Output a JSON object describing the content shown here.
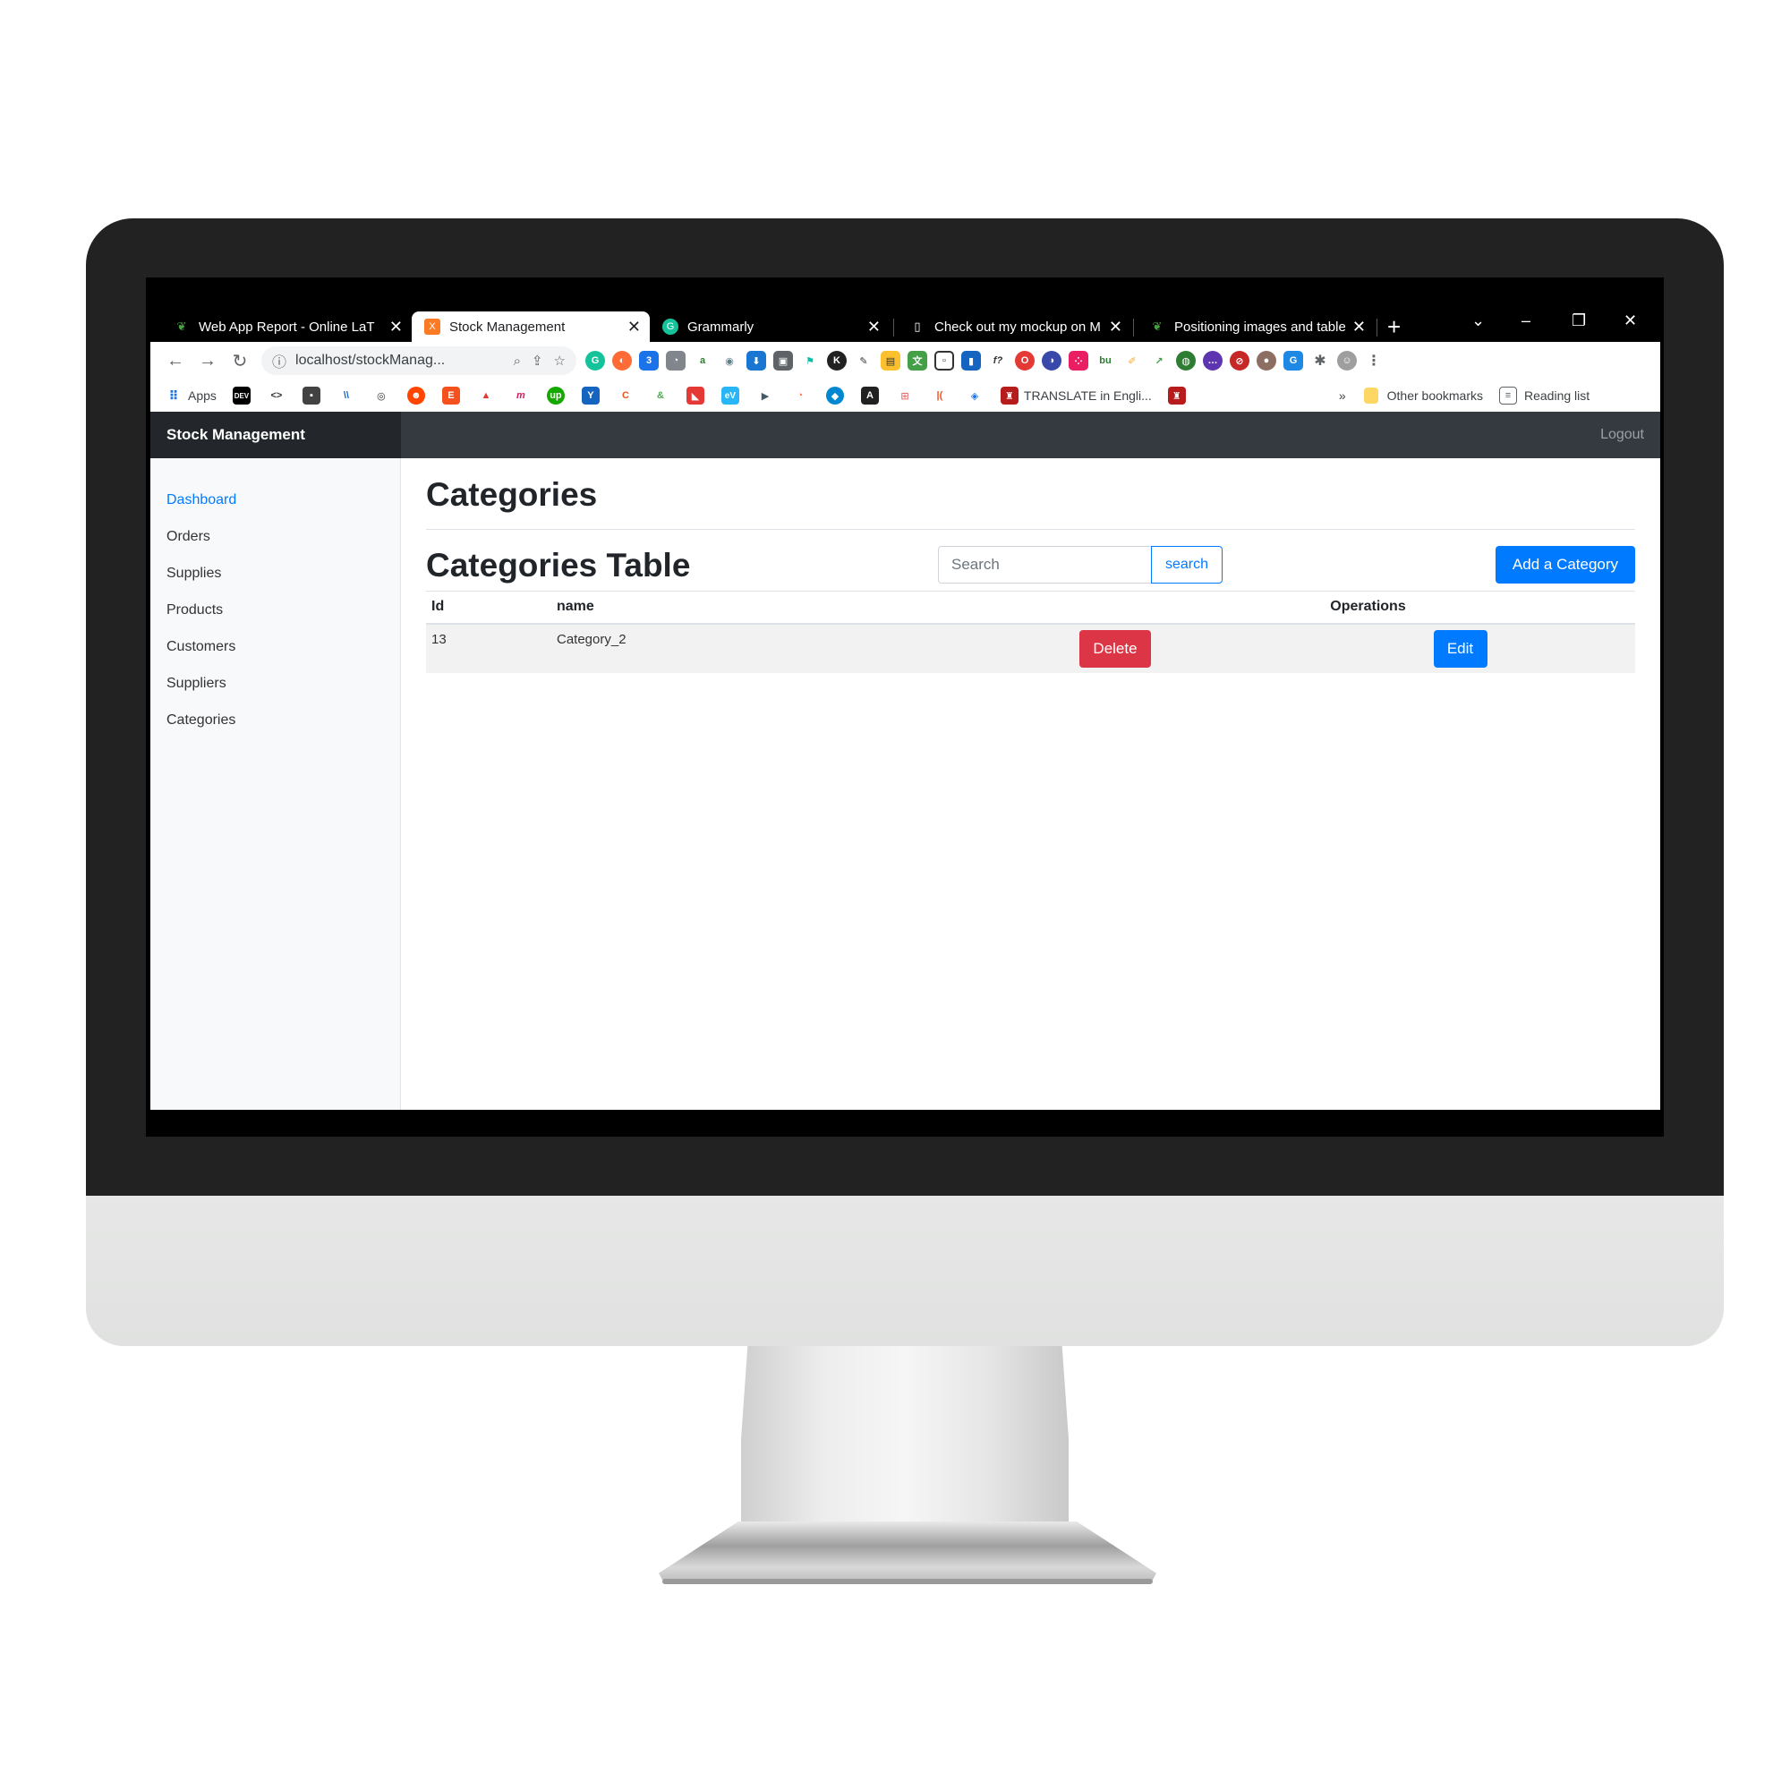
{
  "browser": {
    "tabs": [
      {
        "title": "Web App Report - Online LaT",
        "icon": "overleaf-icon",
        "active": false
      },
      {
        "title": "Stock Management",
        "icon": "xampp-icon",
        "active": true
      },
      {
        "title": "Grammarly",
        "icon": "grammarly-icon",
        "active": false
      },
      {
        "title": "Check out my mockup on M",
        "icon": "mockup-icon",
        "active": false
      },
      {
        "title": "Positioning images and table",
        "icon": "overleaf-icon",
        "active": false
      }
    ],
    "url": "localhost/stockManag...",
    "bookmarks": {
      "apps_label": "Apps",
      "translate_label": "TRANSLATE in Engli...",
      "overflow": "»",
      "other_label": "Other bookmarks",
      "reading_label": "Reading list"
    },
    "colors": {
      "tabbar": "#000000",
      "omnibox": "#f1f3f4"
    }
  },
  "app": {
    "brand": "Stock Management",
    "logout_label": "Logout",
    "sidebar": {
      "items": [
        {
          "label": "Dashboard",
          "active": true
        },
        {
          "label": "Orders",
          "active": false
        },
        {
          "label": "Supplies",
          "active": false
        },
        {
          "label": "Products",
          "active": false
        },
        {
          "label": "Customers",
          "active": false
        },
        {
          "label": "Suppliers",
          "active": false
        },
        {
          "label": "Categories",
          "active": false
        }
      ]
    },
    "main": {
      "page_title": "Categories",
      "table_title": "Categories Table",
      "search": {
        "placeholder": "Search",
        "button_label": "search"
      },
      "add_button_label": "Add a Category",
      "table": {
        "headers": {
          "id": "Id",
          "name": "name",
          "operations": "Operations"
        },
        "rows": [
          {
            "id": "13",
            "name": "Category_2",
            "delete_label": "Delete",
            "edit_label": "Edit"
          }
        ]
      }
    },
    "colors": {
      "primary": "#007bff",
      "danger": "#dc3545",
      "navbar": "#343a40",
      "brand_bg": "#23272b"
    }
  }
}
